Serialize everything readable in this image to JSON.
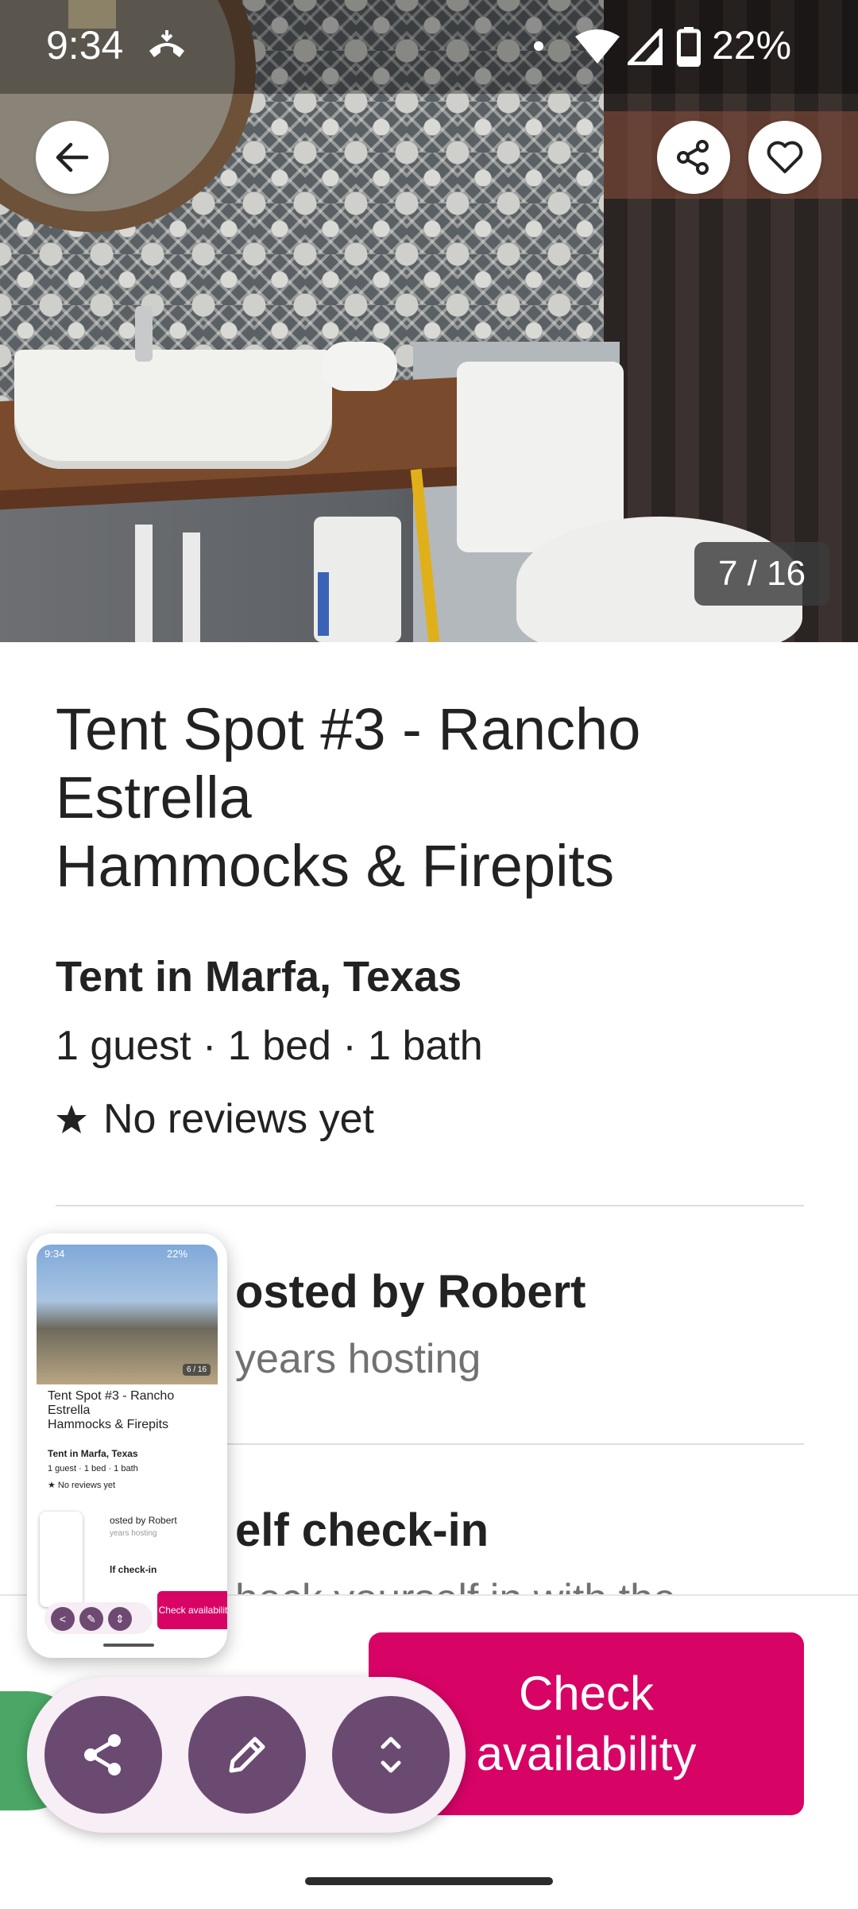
{
  "status_bar": {
    "time": "9:34",
    "battery": "22%"
  },
  "photo": {
    "counter": "7 / 16"
  },
  "listing": {
    "title": "Tent Spot #3 - Rancho Estrella\nHammocks & Firepits",
    "subtitle": "Tent in Marfa, Texas",
    "details": "1 guest · 1 bed · 1 bath",
    "reviews": "No reviews yet"
  },
  "host": {
    "title": "Hosted by Robert",
    "subtitle": "years hosting",
    "visible_title": "osted by Robert"
  },
  "feature": {
    "title": "elf check-in",
    "subtitle": "heck yourself in with the"
  },
  "cta": {
    "check_availability": "Check availability"
  },
  "thumbnail": {
    "time": "9:34",
    "battery": "22%",
    "counter": "6 / 16",
    "title": "Tent Spot #3 - Rancho Estrella\nHammocks & Firepits",
    "subtitle": "Tent in Marfa, Texas",
    "details": "1 guest · 1 bed · 1 bath",
    "reviews": "★ No reviews yet",
    "host": "osted by Robert",
    "host_sub": "years hosting",
    "check_in": "lf check-in",
    "button": "Check availability"
  },
  "colors": {
    "brand": "#d70466",
    "fab": "#6b4a72",
    "pill": "#f7eef6",
    "green": "#4aa765"
  },
  "icons": [
    "back-arrow-icon",
    "share-icon",
    "heart-icon",
    "star-icon",
    "edit-icon",
    "expand-icon"
  ]
}
